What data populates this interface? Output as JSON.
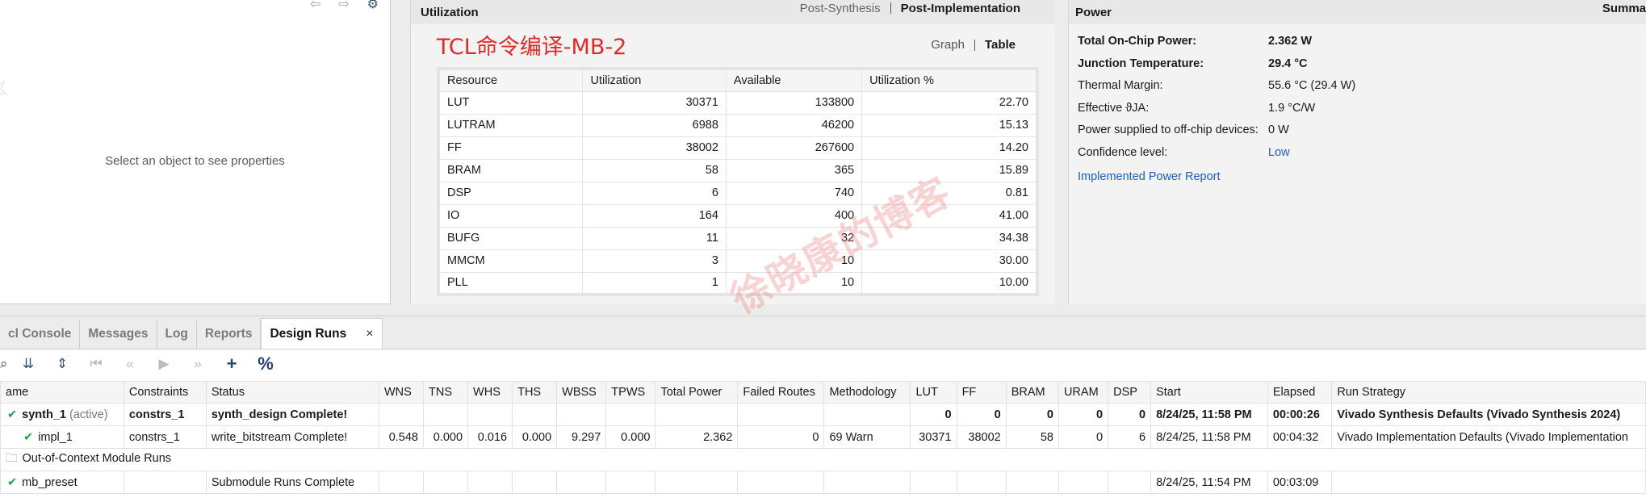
{
  "properties": {
    "hint": "Select an object to see properties",
    "toolbar": [
      "back-arrow-icon",
      "forward-arrow-icon",
      "gear-icon"
    ]
  },
  "utilization": {
    "title": "Utilization",
    "tabs": [
      "Post-Synthesis",
      "Post-Implementation"
    ],
    "active_tab": "Post-Implementation",
    "overlay_title": "TCL命令编译-MB-2",
    "view_toggle": [
      "Graph",
      "Table"
    ],
    "active_view": "Table",
    "columns": [
      "Resource",
      "Utilization",
      "Available",
      "Utilization %"
    ],
    "rows": [
      [
        "LUT",
        "30371",
        "133800",
        "22.70"
      ],
      [
        "LUTRAM",
        "6988",
        "46200",
        "15.13"
      ],
      [
        "FF",
        "38002",
        "267600",
        "14.20"
      ],
      [
        "BRAM",
        "58",
        "365",
        "15.89"
      ],
      [
        "DSP",
        "6",
        "740",
        "0.81"
      ],
      [
        "IO",
        "164",
        "400",
        "41.00"
      ],
      [
        "BUFG",
        "11",
        "32",
        "34.38"
      ],
      [
        "MMCM",
        "3",
        "10",
        "30.00"
      ],
      [
        "PLL",
        "1",
        "10",
        "10.00"
      ]
    ]
  },
  "power": {
    "title": "Power",
    "summary": "Summa",
    "rows": [
      {
        "k": "Total On-Chip Power:",
        "v": "2.362 W",
        "bold": true
      },
      {
        "k": "Junction Temperature:",
        "v": "29.4 °C",
        "bold": true
      },
      {
        "k": "Thermal Margin:",
        "v": "55.6 °C (29.4 W)",
        "bold": false
      },
      {
        "k": "Effective ϑJA:",
        "v": "1.9 °C/W",
        "bold": false
      },
      {
        "k": "Power supplied to off-chip devices:",
        "v": "0 W",
        "bold": false
      },
      {
        "k": "Confidence level:",
        "v": "Low",
        "bold": false,
        "link": true
      }
    ],
    "report_link": "Implemented Power Report"
  },
  "tabs": [
    {
      "label": "cl Console",
      "active": false
    },
    {
      "label": "Messages",
      "active": false
    },
    {
      "label": "Log",
      "active": false
    },
    {
      "label": "Reports",
      "active": false
    },
    {
      "label": "Design Runs",
      "active": true
    }
  ],
  "toolbar": [
    "search-icon",
    "collapse-all-icon",
    "expand-all-icon",
    "first-icon",
    "previous-icon",
    "run-icon",
    "next-icon",
    "add-icon",
    "percent-icon"
  ],
  "runs": {
    "columns": [
      "ame",
      "Constraints",
      "Status",
      "WNS",
      "TNS",
      "WHS",
      "THS",
      "WBSS",
      "TPWS",
      "Total Power",
      "Failed Routes",
      "Methodology",
      "LUT",
      "FF",
      "BRAM",
      "URAM",
      "DSP",
      "Start",
      "Elapsed",
      "Run Strategy"
    ],
    "rows": [
      {
        "name": "synth_1",
        "tag": "(active)",
        "bold": true,
        "check": true,
        "cells": [
          "constrs_1",
          "synth_design Complete!",
          "",
          "",
          "",
          "",
          "",
          "",
          "",
          "",
          "",
          "0",
          "0",
          "0",
          "0",
          "0",
          "8/24/25, 11:58 PM",
          "00:00:26",
          "Vivado Synthesis Defaults (Vivado Synthesis 2024)"
        ]
      },
      {
        "name": "impl_1",
        "tag": "",
        "bold": false,
        "check": true,
        "indent": true,
        "cells": [
          "constrs_1",
          "write_bitstream Complete!",
          "0.548",
          "0.000",
          "0.016",
          "0.000",
          "9.297",
          "0.000",
          "2.362",
          "0",
          "69 Warn",
          "30371",
          "38002",
          "58",
          "0",
          "6",
          "8/24/25, 11:58 PM",
          "00:04:32",
          "Vivado Implementation Defaults (Vivado Implementation"
        ]
      },
      {
        "name": "Out-of-Context Module Runs",
        "group": true,
        "cells": []
      },
      {
        "name": "mb_preset",
        "tag": "",
        "bold": false,
        "check": true,
        "cells": [
          "",
          "Submodule Runs Complete",
          "",
          "",
          "",
          "",
          "",
          "",
          "",
          "",
          "",
          "",
          "",
          "",
          "",
          "",
          "8/24/25, 11:54 PM",
          "00:03:09",
          ""
        ]
      }
    ]
  },
  "watermark": "徐晓康的博客"
}
